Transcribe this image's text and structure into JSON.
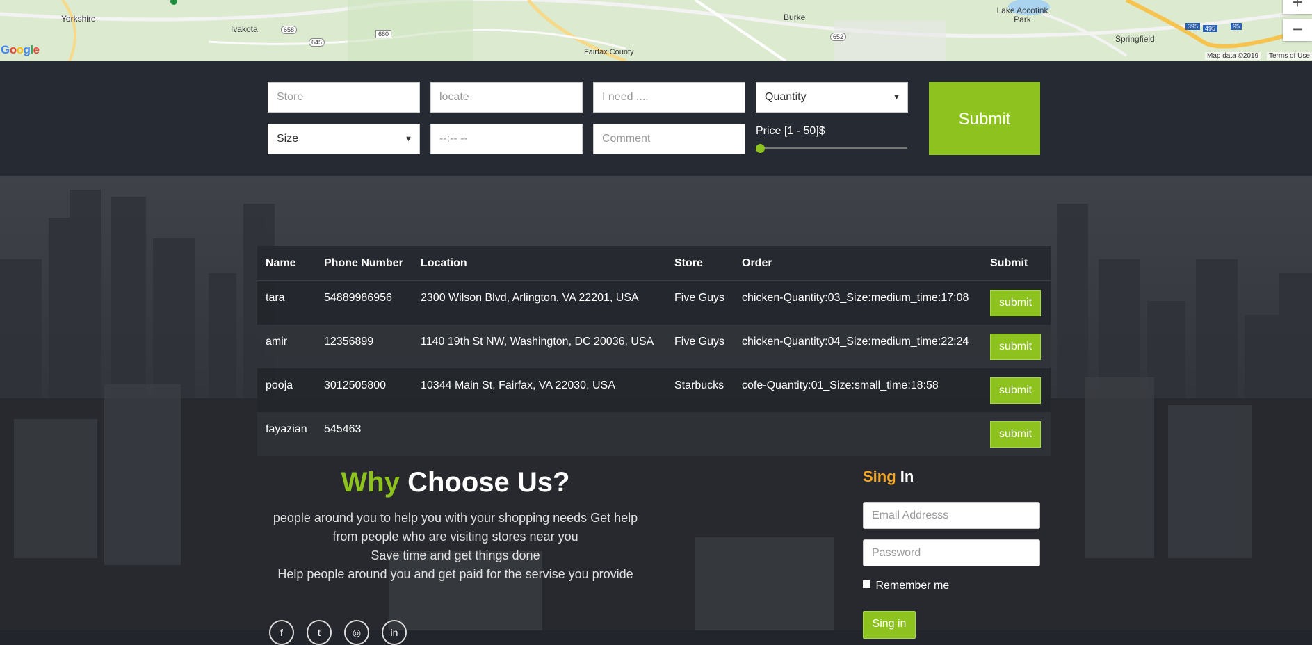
{
  "map": {
    "places": [
      "Yorkshire",
      "Ivakota",
      "Burke",
      "Lake Accotink Park",
      "Springfield",
      "Fairfax County"
    ],
    "shields": [
      "658",
      "645",
      "660",
      "652",
      "395",
      "495",
      "95"
    ],
    "attribution": "Map data ©2019",
    "terms": "Terms of Use",
    "logo": "Google",
    "zoom_in": "+",
    "zoom_out": "−"
  },
  "form": {
    "store_placeholder": "Store",
    "locate_placeholder": "locate",
    "need_placeholder": "I need ....",
    "quantity_selected": "Quantity",
    "size_selected": "Size",
    "time_placeholder": "--:-- --",
    "comment_placeholder": "Comment",
    "price_label": "Price [1 - 50]$",
    "price_value": 1,
    "submit_label": "Submit"
  },
  "table": {
    "headers": [
      "Name",
      "Phone Number",
      "Location",
      "Store",
      "Order",
      "Submit"
    ],
    "rows": [
      {
        "name": "tara",
        "phone": "54889986956",
        "location": "2300 Wilson Blvd, Arlington, VA 22201, USA",
        "store": "Five Guys",
        "order": "chicken-Quantity:03_Size:medium_time:17:08",
        "button": "submit"
      },
      {
        "name": "amir",
        "phone": "12356899",
        "location": "1140 19th St NW, Washington, DC 20036, USA",
        "store": "Five Guys",
        "order": "chicken-Quantity:04_Size:medium_time:22:24",
        "button": "submit"
      },
      {
        "name": "pooja",
        "phone": "3012505800",
        "location": "10344 Main St, Fairfax, VA 22030, USA",
        "store": "Starbucks",
        "order": "cofe-Quantity:01_Size:small_time:18:58",
        "button": "submit"
      },
      {
        "name": "fayazian",
        "phone": "545463",
        "location": "",
        "store": "",
        "order": "",
        "button": "submit"
      }
    ]
  },
  "why": {
    "title_accent": "Why",
    "title_rest": "Choose Us?",
    "lines": [
      "people around you to help you with your shopping needs Get help",
      "from people who are visiting stores near you",
      "Save time and get things done",
      "Help people around you and get paid for the servise you provide"
    ]
  },
  "social_icons": [
    "facebook-icon",
    "twitter-icon",
    "instagram-icon",
    "linkedin-icon"
  ],
  "signin": {
    "title_accent": "Sing",
    "title_rest": "In",
    "email_placeholder": "Email Addresss",
    "password_placeholder": "Password",
    "remember_label": "Remember me",
    "button_label": "Sing in"
  },
  "colors": {
    "accent_green": "#8dc21f",
    "accent_orange": "#f5a623",
    "dark_bar": "#262a32"
  }
}
